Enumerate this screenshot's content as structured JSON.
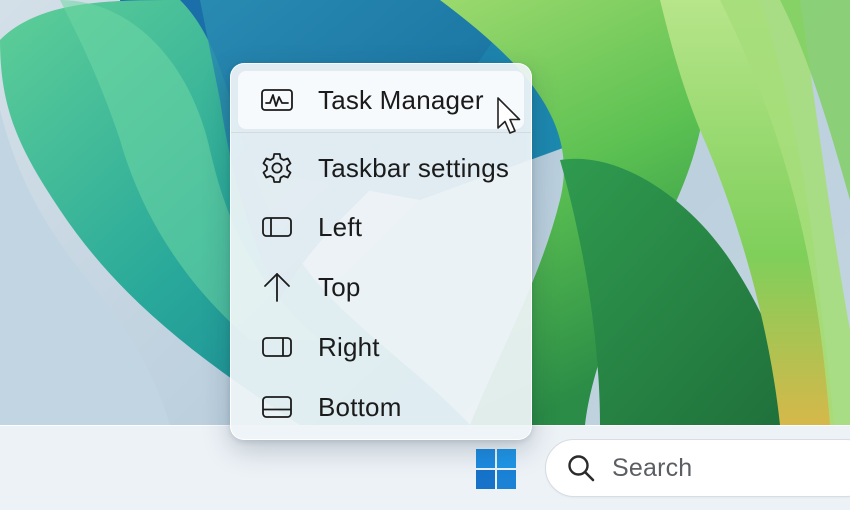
{
  "menu": {
    "items": [
      {
        "label": "Task Manager",
        "icon": "task-manager-icon"
      },
      {
        "label": "Taskbar settings",
        "icon": "gear-icon"
      },
      {
        "label": "Left",
        "icon": "dock-left-icon"
      },
      {
        "label": "Top",
        "icon": "arrow-up-icon"
      },
      {
        "label": "Right",
        "icon": "dock-right-icon"
      },
      {
        "label": "Bottom",
        "icon": "dock-bottom-icon"
      }
    ]
  },
  "taskbar": {
    "start_icon": "windows-logo-icon",
    "search": {
      "placeholder": "Search",
      "icon": "search-icon"
    }
  },
  "colors": {
    "windows_blue": "#1e8fe0",
    "menu_bg": "#eff4f8",
    "text": "#1b1b1b"
  }
}
